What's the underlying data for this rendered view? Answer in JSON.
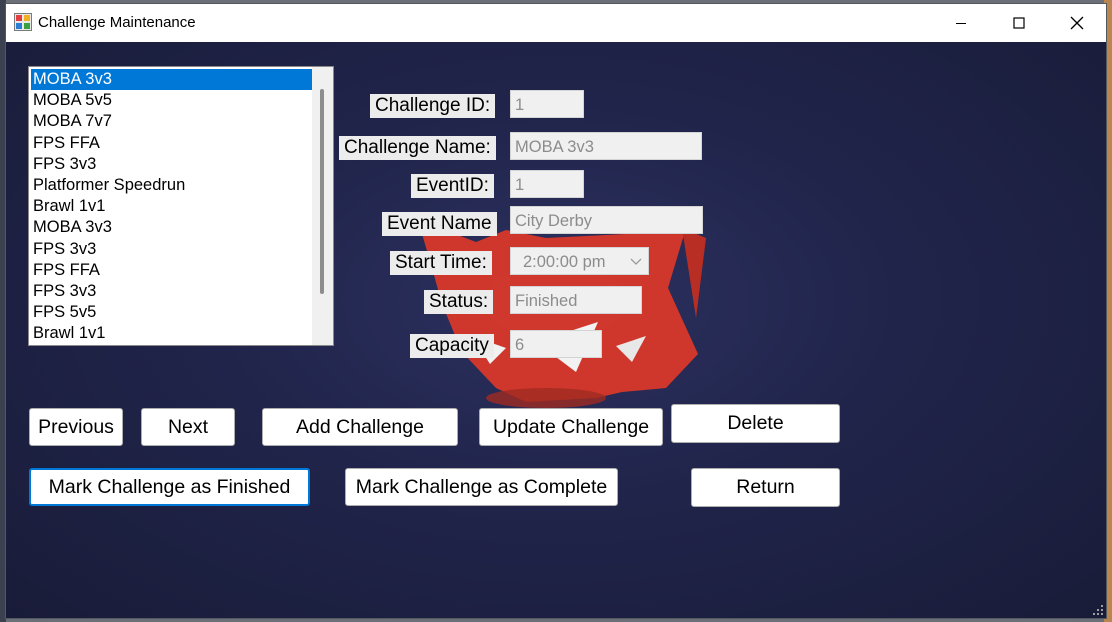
{
  "window": {
    "title": "Challenge Maintenance",
    "icons": {
      "app": "app-form-icon",
      "minimize": "minimize-icon",
      "maximize": "maximize-icon",
      "close": "close-icon"
    }
  },
  "challenge_list": {
    "items": [
      "MOBA 3v3",
      "MOBA 5v5",
      "MOBA 7v7",
      "FPS FFA",
      "FPS 3v3",
      "Platformer Speedrun",
      "Brawl 1v1",
      "MOBA 3v3",
      "FPS 3v3",
      "FPS FFA",
      "FPS 3v3",
      "FPS 5v5",
      "Brawl 1v1"
    ],
    "selected_index": 0
  },
  "form": {
    "challenge_id": {
      "label": "Challenge ID:",
      "value": "1"
    },
    "challenge_name": {
      "label": "Challenge Name:",
      "value": "MOBA 3v3"
    },
    "event_id": {
      "label": "EventID:",
      "value": "1"
    },
    "event_name": {
      "label": "Event Name",
      "value": "City Derby"
    },
    "start_time": {
      "label": "Start Time:",
      "value": "2:00:00 pm"
    },
    "status": {
      "label": "Status:",
      "value": "Finished"
    },
    "capacity": {
      "label": "Capacity",
      "value": "6"
    }
  },
  "buttons": {
    "previous": "Previous",
    "next": "Next",
    "add": "Add Challenge",
    "update": "Update Challenge",
    "delete": "Delete",
    "mark_finished": "Mark Challenge as Finished",
    "mark_complete": "Mark Challenge as Complete",
    "return": "Return"
  },
  "colors": {
    "background": "#1e2240",
    "selection": "#0078d7",
    "mascot": "#d9382a"
  }
}
